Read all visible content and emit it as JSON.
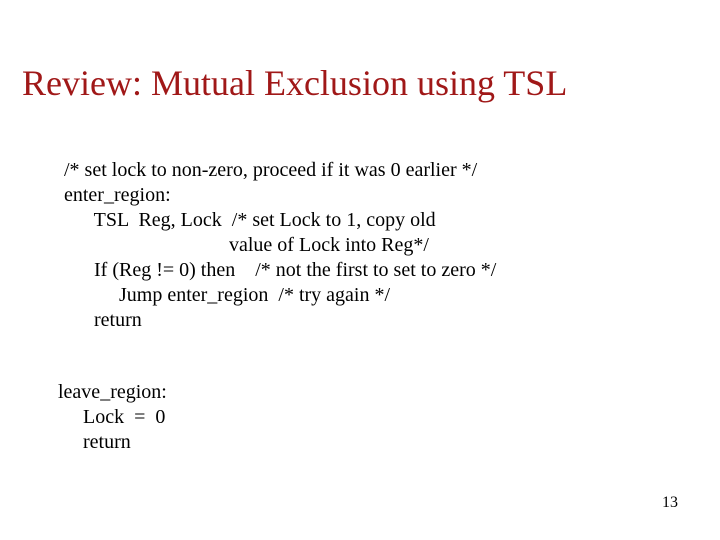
{
  "title": "Review: Mutual Exclusion using TSL",
  "code1": {
    "l1": "/* set lock to non-zero, proceed if it was 0 earlier */",
    "l2": "enter_region:",
    "l3": "      TSL  Reg, Lock  /* set Lock to 1, copy old",
    "l4": "                                 value of Lock into Reg*/",
    "l5": "      If (Reg != 0) then    /* not the first to set to zero */",
    "l6": "           Jump enter_region  /* try again */",
    "l7": "      return"
  },
  "code2": {
    "l1": "leave_region:",
    "l2": "     Lock  =  0",
    "l3": "     return"
  },
  "page_number": "13"
}
